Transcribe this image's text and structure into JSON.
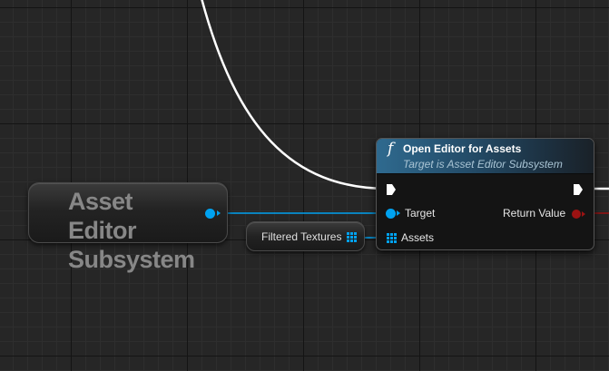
{
  "subsystem_node": {
    "title_line1": "Asset Editor",
    "title_line2": "Subsystem"
  },
  "variable_node": {
    "label": "Filtered Textures"
  },
  "function_node": {
    "icon": "f",
    "title": "Open Editor for Assets",
    "subtitle": "Target is Asset Editor Subsystem",
    "pins": {
      "target": "Target",
      "assets": "Assets",
      "return_value": "Return Value"
    }
  },
  "colors": {
    "object_pin": "#00a2f0",
    "exec_wire": "#ffffff",
    "return_pin": "#9b1212",
    "grid_background": "#262626"
  }
}
